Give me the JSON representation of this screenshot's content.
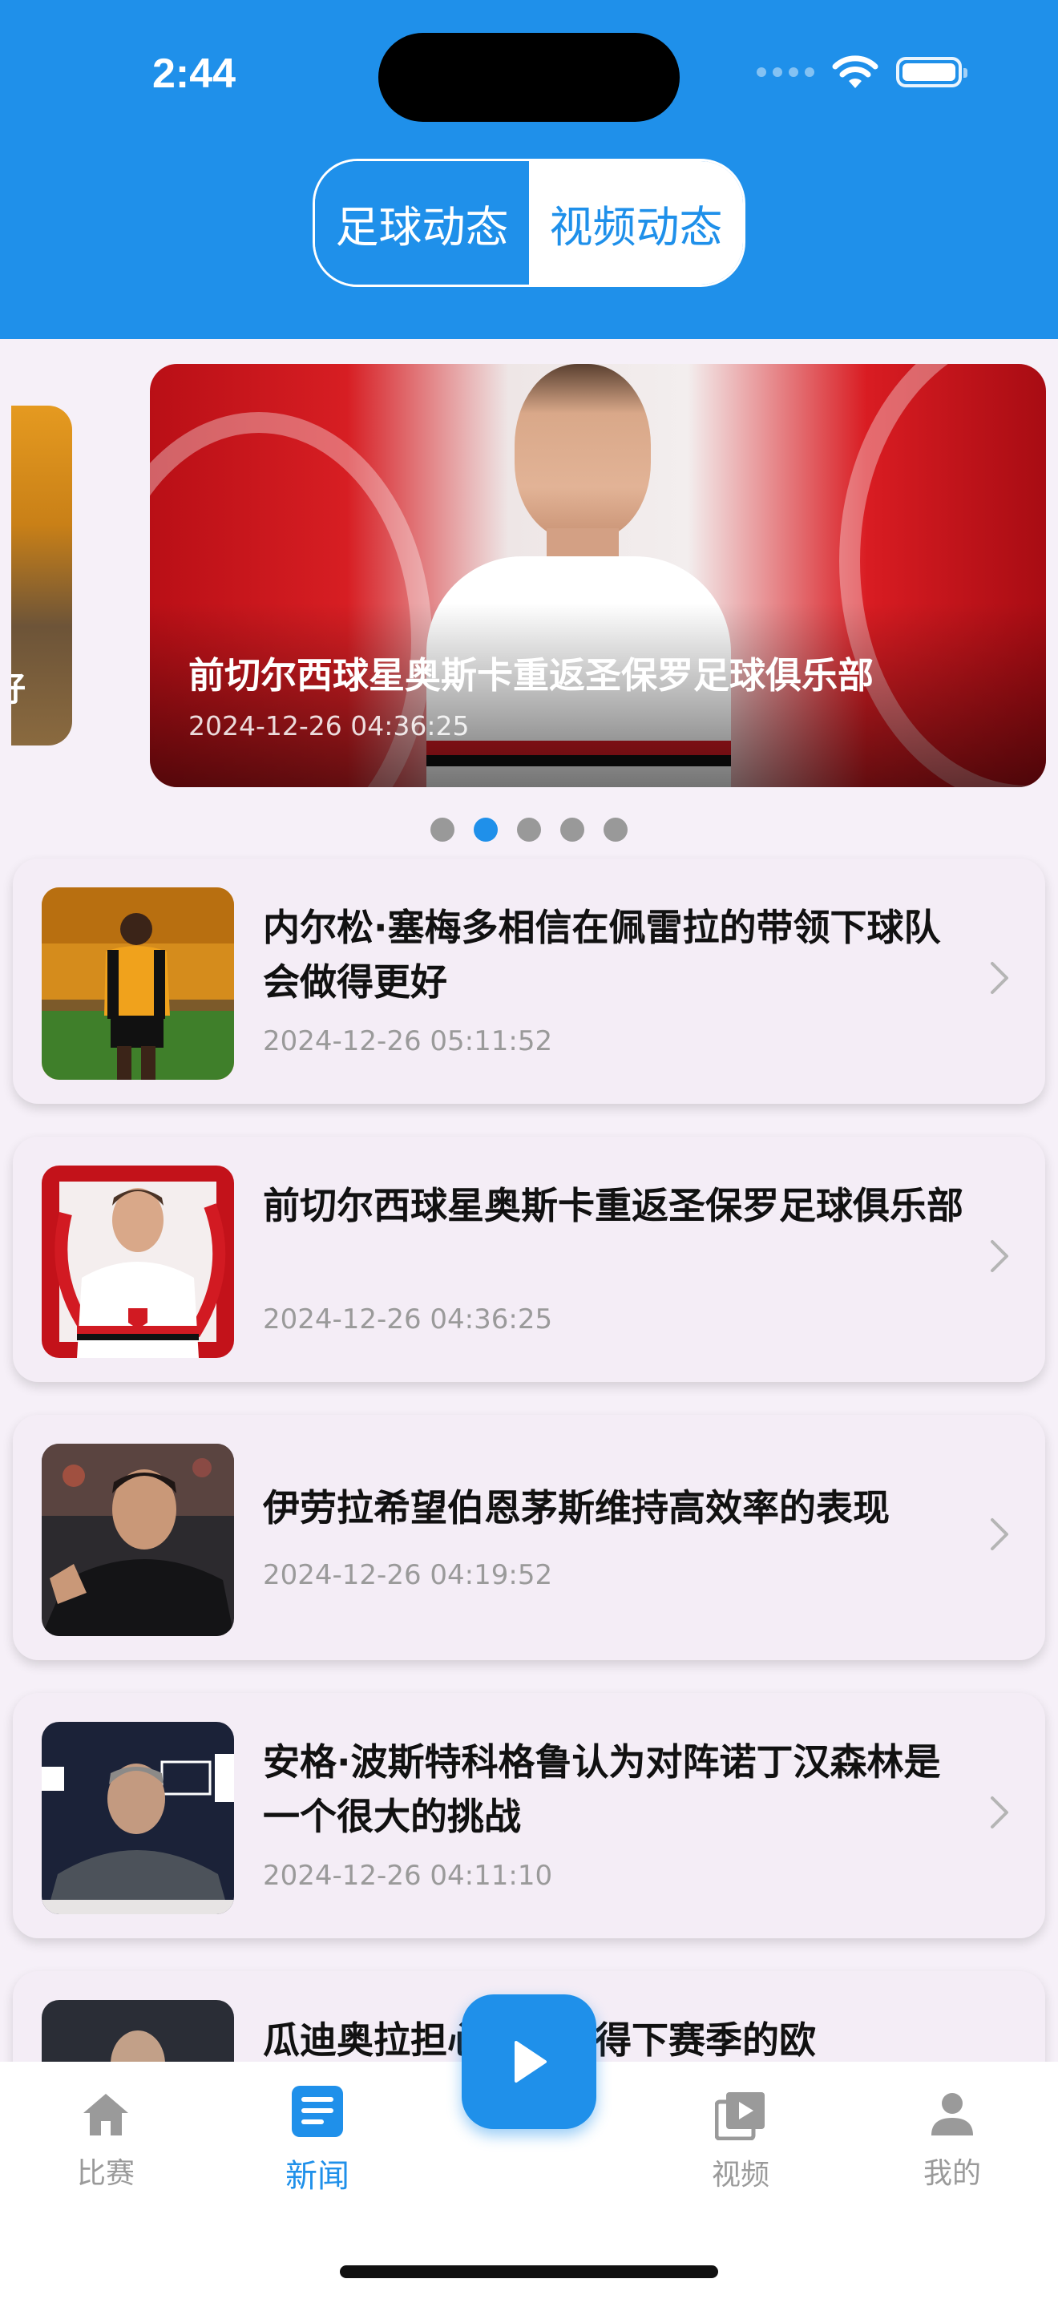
{
  "status_bar": {
    "time": "2:44"
  },
  "segmented": {
    "tabs": [
      "足球动态",
      "视频动态"
    ],
    "active_index": 0
  },
  "carousel": {
    "peek_text": "好",
    "banner": {
      "title": "前切尔西球星奥斯卡重返圣保罗足球俱乐部",
      "time": "2024-12-26 04:36:25"
    },
    "page_count": 5,
    "active_page": 1
  },
  "news": [
    {
      "title": "内尔松·塞梅多相信在佩雷拉的带领下球队会做得更好",
      "time": "2024-12-26 05:11:52",
      "thumb_icon": "wolves-player-photo"
    },
    {
      "title": "前切尔西球星奥斯卡重返圣保罗足球俱乐部",
      "time": "2024-12-26 04:36:25",
      "thumb_icon": "oscar-spfc-photo"
    },
    {
      "title": "伊劳拉希望伯恩茅斯维持高效率的表现",
      "time": "2024-12-26 04:19:52",
      "thumb_icon": "manager-photo"
    },
    {
      "title": "安格·波斯特科格鲁认为对阵诺丁汉森林是一个很大的挑战",
      "time": "2024-12-26 04:11:10",
      "thumb_icon": "press-conference-photo"
    },
    {
      "title": "瓜迪奥拉担心无法获得下赛季的欧",
      "time": "",
      "thumb_icon": "guardiola-photo"
    }
  ],
  "tabbar": {
    "items": [
      {
        "label": "比赛",
        "icon": "home-icon"
      },
      {
        "label": "新闻",
        "icon": "news-icon"
      },
      {
        "label": "视频",
        "icon": "video-library-icon"
      },
      {
        "label": "我的",
        "icon": "person-icon"
      }
    ],
    "active_index": 1
  },
  "colors": {
    "primary": "#1f90ea",
    "background": "#f6f0f8",
    "card": "#f4edf6"
  }
}
